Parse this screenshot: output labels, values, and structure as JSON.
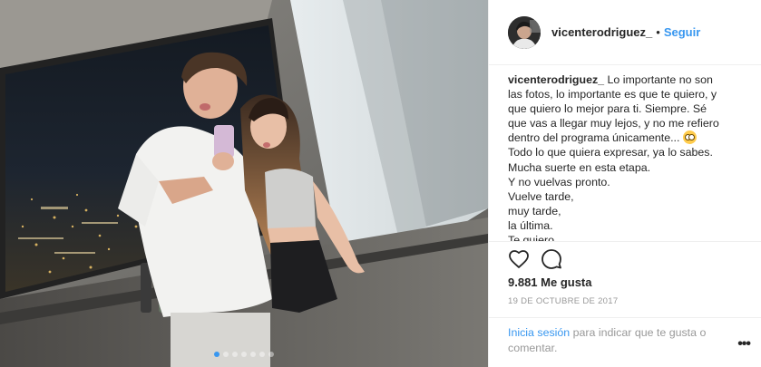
{
  "post": {
    "username": "vicenterodriguez_",
    "header_separator": "•",
    "follow_label": "Seguir",
    "caption": {
      "username": "vicenterodriguez_",
      "lines": [
        "Lo importante no son",
        "las fotos, lo importante es que te quiero, y",
        "que quiero lo mejor para ti. Siempre. Sé",
        "que vas a llegar muy lejos, y no me refiero",
        "dentro del programa únicamente...",
        "Todo lo que quiera expresar, ya lo sabes.",
        "Mucha suerte en esta etapa.",
        "Y no vuelvas pronto.",
        "Vuelve tarde,",
        "muy tarde,",
        "la última.",
        "Te quiero."
      ],
      "emoji": "flushed-face-emoji"
    },
    "likes": "9.881 Me gusta",
    "date": "19 DE OCTUBRE DE 2017",
    "login": {
      "link": "Inicia sesión",
      "text": " para indicar que te gusta o comentar."
    },
    "more_label": "•••",
    "carousel": {
      "count": 7,
      "active_index": 0
    },
    "icons": [
      "heart-icon",
      "comment-icon",
      "more-options-icon"
    ],
    "colors": {
      "accent": "#3897f0",
      "text": "#262626",
      "muted": "#999999",
      "border": "#efefef"
    }
  }
}
